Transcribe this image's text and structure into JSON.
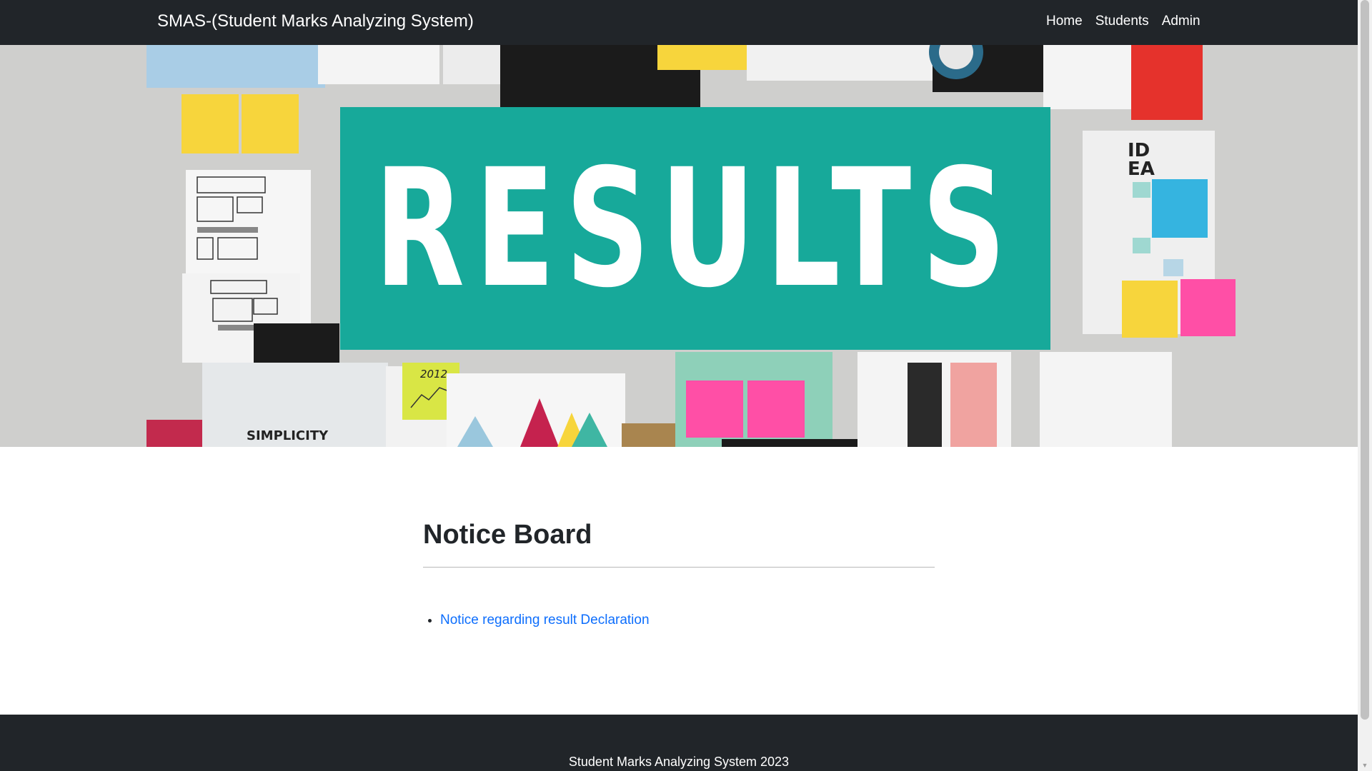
{
  "navbar": {
    "brand": "SMAS-(Student Marks Analyzing System)",
    "links": [
      "Home",
      "Students",
      "Admin"
    ]
  },
  "hero": {
    "headline": "RESULTS",
    "labels": {
      "simplicity": "SIMPLICITY",
      "year": "2012",
      "idea": "IDEA"
    },
    "colors": {
      "board": "#17a99a",
      "pink": "#ff4fa6",
      "yellow": "#f7d53c",
      "blue": "#35b4e0",
      "red": "#e5322c"
    }
  },
  "notice_board": {
    "title": "Notice Board",
    "items": [
      "Notice regarding result Declaration"
    ]
  },
  "footer": {
    "text": "Student Marks Analyzing System 2023"
  }
}
